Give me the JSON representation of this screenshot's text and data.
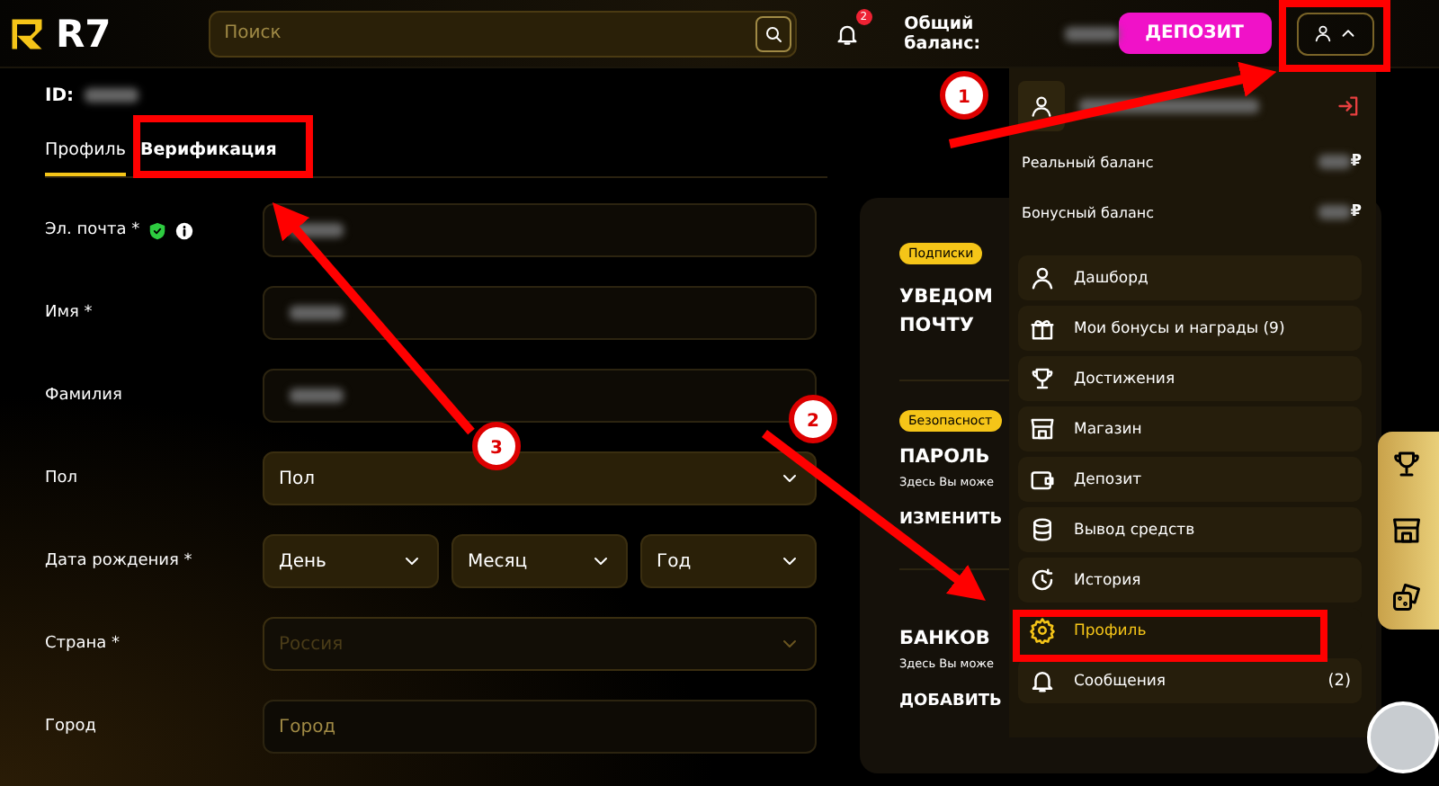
{
  "header": {
    "logo": "R7",
    "search": {
      "placeholder": "Поиск"
    },
    "notifications_badge": "2",
    "balance_label": "Общий баланс:",
    "balance_redacted": true,
    "deposit_button": "ДЕПОЗИТ",
    "user_menu_expanded": true
  },
  "account": {
    "id_label": "ID:",
    "id_redacted": true
  },
  "tabs": [
    {
      "label": "Профиль",
      "selected": true
    },
    {
      "label": "Верификация",
      "selected": false
    }
  ],
  "form": [
    {
      "kind": "text",
      "label": "Эл. почта *",
      "verified": true,
      "info": true,
      "value_redacted": true
    },
    {
      "kind": "text",
      "label": "Имя *",
      "value_redacted": true
    },
    {
      "kind": "text",
      "label": "Фамилия",
      "value_redacted": true
    },
    {
      "kind": "select",
      "label": "Пол",
      "value": "Пол"
    },
    {
      "kind": "date",
      "label": "Дата рождения *",
      "parts": [
        "День",
        "Месяц",
        "Год"
      ]
    },
    {
      "kind": "select",
      "label": "Страна *",
      "value": "Россия",
      "disabled": true
    },
    {
      "kind": "text",
      "label": "Город",
      "placeholder": "Город"
    }
  ],
  "settings_card": {
    "sections": [
      {
        "badge": "Подписки",
        "title": [
          "УВЕДОМ",
          "ПОЧТУ"
        ]
      },
      {
        "badge": "Безопасност",
        "title": [
          "ПАРОЛЬ"
        ],
        "text": "Здесь Вы може",
        "action": "ИЗМЕНИТЬ"
      },
      {
        "title": [
          "БАНКОВ"
        ],
        "text": "Здесь Вы може",
        "action": "ДОБАВИТЬ"
      }
    ]
  },
  "user_menu": {
    "name_redacted": true,
    "balances": [
      {
        "label": "Реальный баланс",
        "currency": "₽"
      },
      {
        "label": "Бонусный баланс",
        "currency": "₽"
      }
    ],
    "items": [
      {
        "label": "Дашборд",
        "selected": false
      },
      {
        "label": "Мои бонусы и награды (9)",
        "selected": false
      },
      {
        "label": "Достижения",
        "selected": false
      },
      {
        "label": "Магазин",
        "selected": false
      },
      {
        "label": "Депозит",
        "selected": false
      },
      {
        "label": "Вывод средств",
        "selected": false
      },
      {
        "label": "История",
        "selected": false
      },
      {
        "label": "Профиль",
        "selected": true
      },
      {
        "label": "Сообщения",
        "count": "(2)",
        "selected": false
      }
    ]
  },
  "annotations": [
    {
      "label": "1"
    },
    {
      "label": "2"
    },
    {
      "label": "3"
    }
  ]
}
